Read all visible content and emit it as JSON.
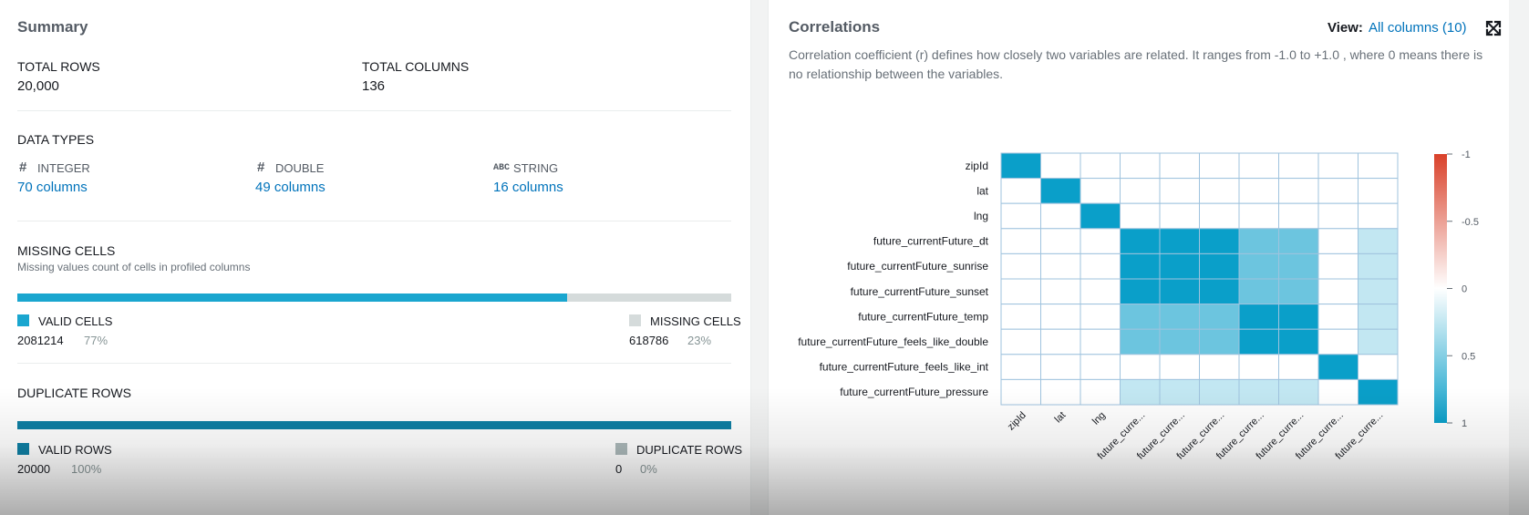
{
  "summary": {
    "title": "Summary",
    "total_rows_label": "TOTAL ROWS",
    "total_rows_value": "20,000",
    "total_columns_label": "TOTAL COLUMNS",
    "total_columns_value": "136",
    "data_types": {
      "title": "DATA TYPES",
      "items": [
        {
          "icon": "hash-icon",
          "glyph": "#",
          "label": "INTEGER",
          "count": "70 columns"
        },
        {
          "icon": "hash-icon",
          "glyph": "#",
          "label": "DOUBLE",
          "count": "49 columns"
        },
        {
          "icon": "abc-icon",
          "glyph": "ABC",
          "label": "STRING",
          "count": "16 columns"
        }
      ]
    },
    "missing_cells": {
      "title": "MISSING CELLS",
      "subtitle": "Missing values count of cells in profiled columns",
      "valid_fraction": 0.77,
      "valid_label": "VALID CELLS",
      "valid_value": "2081214",
      "valid_pct": "77%",
      "missing_label": "MISSING CELLS",
      "missing_value": "618786",
      "missing_pct": "23%",
      "valid_color": "#1aa6cf",
      "missing_color": "#d5dbdb"
    },
    "duplicate_rows": {
      "title": "DUPLICATE ROWS",
      "valid_fraction": 1.0,
      "valid_label": "VALID ROWS",
      "valid_value": "20000",
      "valid_pct": "100%",
      "dup_label": "DUPLICATE ROWS",
      "dup_value": "0",
      "dup_pct": "0%",
      "valid_color": "#0f7fa3",
      "dup_color": "#aab7b8"
    }
  },
  "correlations": {
    "title": "Correlations",
    "view_label": "View:",
    "view_value": "All columns (10)",
    "expand_icon": "expand-icon",
    "description": "Correlation coefficient (r) defines how closely two variables are related. It ranges from -1.0 to +1.0 , where 0 means there is no relationship between the variables.",
    "row_labels": [
      "zipId",
      "lat",
      "lng",
      "future_currentFuture_dt",
      "future_currentFuture_sunrise",
      "future_currentFuture_sunset",
      "future_currentFuture_temp",
      "future_currentFuture_feels_like_double",
      "future_currentFuture_feels_like_int",
      "future_currentFuture_pressure"
    ],
    "col_labels": [
      "zipId",
      "lat",
      "lng",
      "future_curre...",
      "future_curre...",
      "future_curre...",
      "future_curre...",
      "future_curre...",
      "future_curre...",
      "future_curre..."
    ],
    "matrix": [
      [
        1,
        0,
        0,
        0,
        0,
        0,
        0,
        0,
        0,
        0
      ],
      [
        0,
        1,
        0,
        0,
        0,
        0,
        0,
        0,
        0,
        0
      ],
      [
        0,
        0,
        1,
        0,
        0,
        0,
        0,
        0,
        0,
        0
      ],
      [
        0,
        0,
        0,
        1,
        1,
        1,
        0.6,
        0.6,
        0,
        0.25
      ],
      [
        0,
        0,
        0,
        1,
        1,
        1,
        0.6,
        0.6,
        0,
        0.25
      ],
      [
        0,
        0,
        0,
        1,
        1,
        1,
        0.6,
        0.6,
        0,
        0.25
      ],
      [
        0,
        0,
        0,
        0.6,
        0.6,
        0.6,
        1,
        1,
        0,
        0.25
      ],
      [
        0,
        0,
        0,
        0.6,
        0.6,
        0.6,
        1,
        1,
        0,
        0.25
      ],
      [
        0,
        0,
        0,
        0,
        0,
        0,
        0,
        0,
        1,
        0
      ],
      [
        0,
        0,
        0,
        0.25,
        0.25,
        0.25,
        0.25,
        0.25,
        0,
        1
      ]
    ],
    "scale_ticks": [
      "-1",
      "-0.5",
      "0",
      "0.5",
      "1"
    ],
    "scale_colors": {
      "negative": "#d9412a",
      "zero": "#ffffff",
      "positive": "#0a9fc9"
    }
  }
}
